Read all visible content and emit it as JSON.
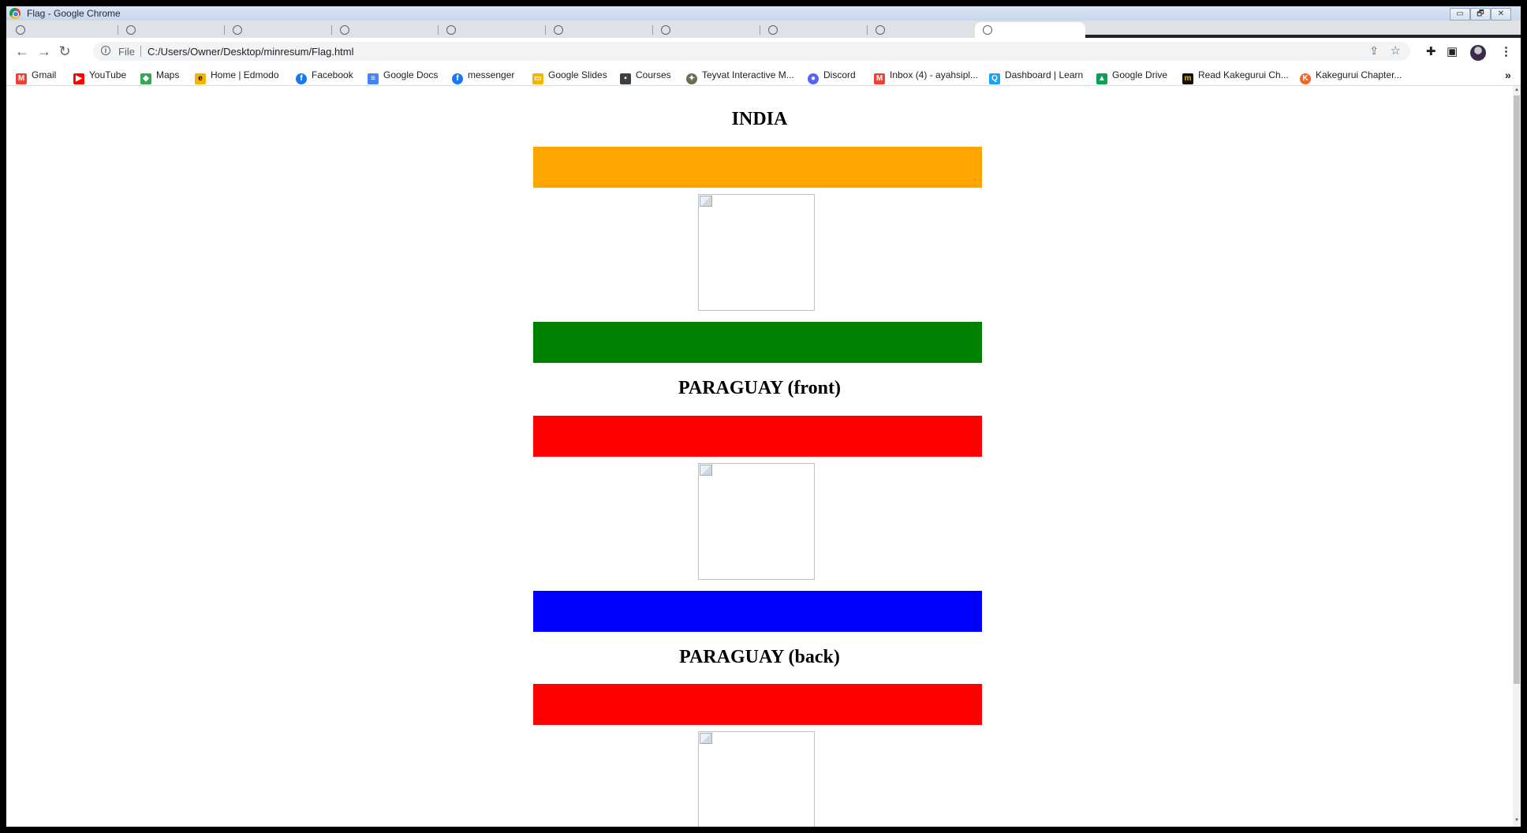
{
  "window": {
    "title": "Flag - Google Chrome",
    "controls": [
      "▭",
      "🗗",
      "✕"
    ]
  },
  "address_bar": {
    "scheme_label": "File",
    "url": "C:/Users/Owner/Desktop/minresum/Flag.html"
  },
  "bookmarks": [
    {
      "label": "Gmail",
      "icon": "gmail-icon",
      "color": "#ea4335"
    },
    {
      "label": "YouTube",
      "icon": "youtube-icon",
      "color": "#ff0000"
    },
    {
      "label": "Maps",
      "icon": "maps-icon",
      "color": "#34a853"
    },
    {
      "label": "Home | Edmodo",
      "icon": "edmodo-icon",
      "color": "#f4b400"
    },
    {
      "label": "Facebook",
      "icon": "facebook-icon",
      "color": "#1877f2"
    },
    {
      "label": "Google Docs",
      "icon": "docs-icon",
      "color": "#4285f4"
    },
    {
      "label": "messenger",
      "icon": "messenger-icon",
      "color": "#1877f2"
    },
    {
      "label": "Google Slides",
      "icon": "slides-icon",
      "color": "#f4b400"
    },
    {
      "label": "Courses",
      "icon": "courses-icon",
      "color": "#3c4043"
    },
    {
      "label": "Teyvat Interactive M...",
      "icon": "teyvat-icon",
      "color": "#6d6d4f"
    },
    {
      "label": "Discord",
      "icon": "discord-icon",
      "color": "#5865f2"
    },
    {
      "label": "Inbox (4) - ayahsipl...",
      "icon": "gmail-icon",
      "color": "#ea4335"
    },
    {
      "label": "Dashboard | Learn",
      "icon": "learn-icon",
      "color": "#1da1f2"
    },
    {
      "label": "Google Drive",
      "icon": "drive-icon",
      "color": "#0f9d58"
    },
    {
      "label": "Read Kakegurui Ch...",
      "icon": "manga-icon",
      "color": "#111111"
    },
    {
      "label": "Kakegurui Chapter...",
      "icon": "kakegurui-icon",
      "color": "#f26522"
    }
  ],
  "bookmarks_more": "»",
  "page": {
    "india": {
      "title": "INDIA",
      "top_color": "#ffa500",
      "bottom_color": "#008000"
    },
    "paraguay_front": {
      "title": "PARAGUAY (front)",
      "top_color": "#ff0000",
      "bottom_color": "#0000ff"
    },
    "paraguay_back": {
      "title": "PARAGUAY (back)",
      "top_color": "#ff0000"
    }
  }
}
